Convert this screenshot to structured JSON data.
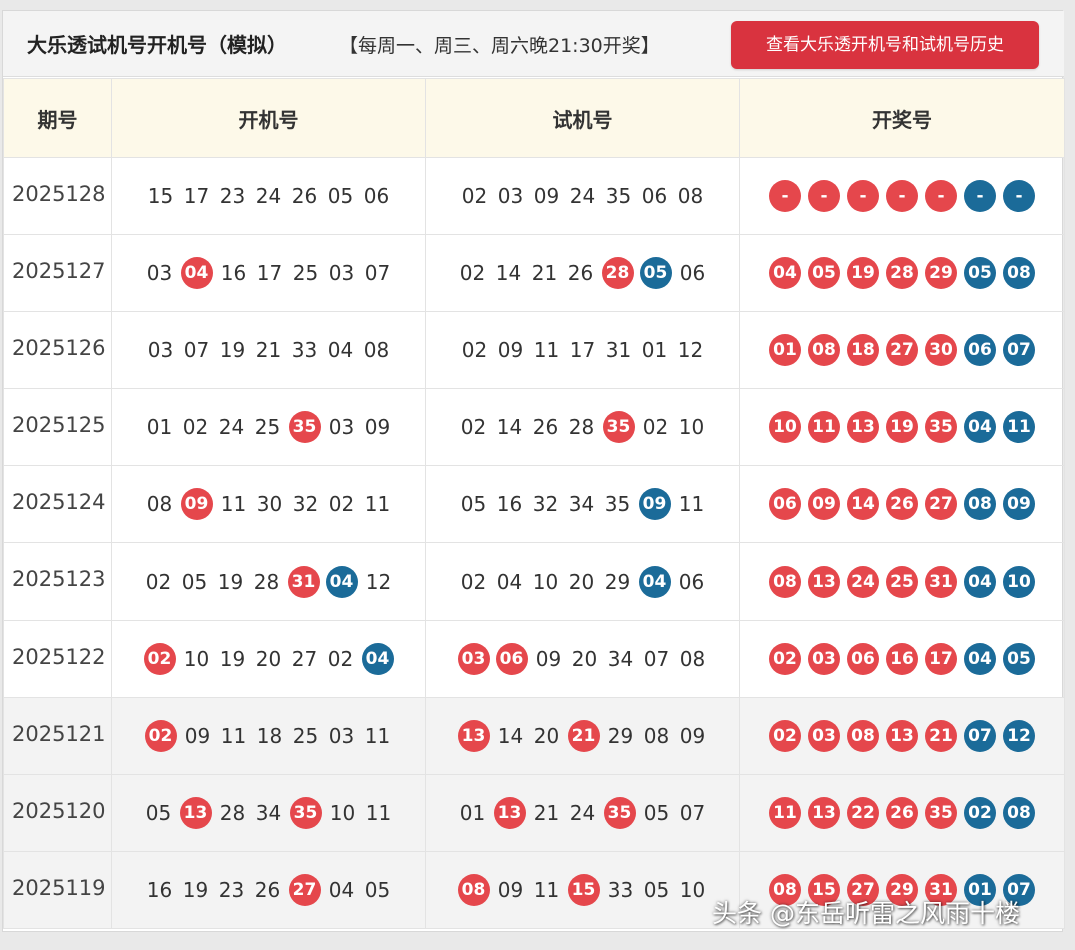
{
  "header": {
    "title": "大乐透试机号开机号（模拟）",
    "schedule": "【每周一、周三、周六晚21:30开奖】",
    "history_button": "查看大乐透开机号和试机号历史"
  },
  "columns": [
    "期号",
    "开机号",
    "试机号",
    "开奖号"
  ],
  "colors": {
    "red_ball": "#e5474c",
    "blue_ball": "#1b6b99",
    "button": "#d9333f",
    "header_bg": "#fdf9e9"
  },
  "rows": [
    {
      "issue": "2025128",
      "open": [
        [
          "15",
          ""
        ],
        [
          "17",
          ""
        ],
        [
          "23",
          ""
        ],
        [
          "24",
          ""
        ],
        [
          "26",
          ""
        ],
        [
          "05",
          ""
        ],
        [
          "06",
          ""
        ]
      ],
      "trial": [
        [
          "02",
          ""
        ],
        [
          "03",
          ""
        ],
        [
          "09",
          ""
        ],
        [
          "24",
          ""
        ],
        [
          "35",
          ""
        ],
        [
          "06",
          ""
        ],
        [
          "08",
          ""
        ]
      ],
      "result": [
        "-",
        "-",
        "-",
        "-",
        "-",
        "-",
        "-"
      ]
    },
    {
      "issue": "2025127",
      "open": [
        [
          "03",
          ""
        ],
        [
          "04",
          "red"
        ],
        [
          "16",
          ""
        ],
        [
          "17",
          ""
        ],
        [
          "25",
          ""
        ],
        [
          "03",
          ""
        ],
        [
          "07",
          ""
        ]
      ],
      "trial": [
        [
          "02",
          ""
        ],
        [
          "14",
          ""
        ],
        [
          "21",
          ""
        ],
        [
          "26",
          ""
        ],
        [
          "28",
          "red"
        ],
        [
          "05",
          "blue"
        ],
        [
          "06",
          ""
        ]
      ],
      "result": [
        "04",
        "05",
        "19",
        "28",
        "29",
        "05",
        "08"
      ]
    },
    {
      "issue": "2025126",
      "open": [
        [
          "03",
          ""
        ],
        [
          "07",
          ""
        ],
        [
          "19",
          ""
        ],
        [
          "21",
          ""
        ],
        [
          "33",
          ""
        ],
        [
          "04",
          ""
        ],
        [
          "08",
          ""
        ]
      ],
      "trial": [
        [
          "02",
          ""
        ],
        [
          "09",
          ""
        ],
        [
          "11",
          ""
        ],
        [
          "17",
          ""
        ],
        [
          "31",
          ""
        ],
        [
          "01",
          ""
        ],
        [
          "12",
          ""
        ]
      ],
      "result": [
        "01",
        "08",
        "18",
        "27",
        "30",
        "06",
        "07"
      ]
    },
    {
      "issue": "2025125",
      "open": [
        [
          "01",
          ""
        ],
        [
          "02",
          ""
        ],
        [
          "24",
          ""
        ],
        [
          "25",
          ""
        ],
        [
          "35",
          "red"
        ],
        [
          "03",
          ""
        ],
        [
          "09",
          ""
        ]
      ],
      "trial": [
        [
          "02",
          ""
        ],
        [
          "14",
          ""
        ],
        [
          "26",
          ""
        ],
        [
          "28",
          ""
        ],
        [
          "35",
          "red"
        ],
        [
          "02",
          ""
        ],
        [
          "10",
          ""
        ]
      ],
      "result": [
        "10",
        "11",
        "13",
        "19",
        "35",
        "04",
        "11"
      ]
    },
    {
      "issue": "2025124",
      "open": [
        [
          "08",
          ""
        ],
        [
          "09",
          "red"
        ],
        [
          "11",
          ""
        ],
        [
          "30",
          ""
        ],
        [
          "32",
          ""
        ],
        [
          "02",
          ""
        ],
        [
          "11",
          ""
        ]
      ],
      "trial": [
        [
          "05",
          ""
        ],
        [
          "16",
          ""
        ],
        [
          "32",
          ""
        ],
        [
          "34",
          ""
        ],
        [
          "35",
          ""
        ],
        [
          "09",
          "blue"
        ],
        [
          "11",
          ""
        ]
      ],
      "result": [
        "06",
        "09",
        "14",
        "26",
        "27",
        "08",
        "09"
      ]
    },
    {
      "issue": "2025123",
      "open": [
        [
          "02",
          ""
        ],
        [
          "05",
          ""
        ],
        [
          "19",
          ""
        ],
        [
          "28",
          ""
        ],
        [
          "31",
          "red"
        ],
        [
          "04",
          "blue"
        ],
        [
          "12",
          ""
        ]
      ],
      "trial": [
        [
          "02",
          ""
        ],
        [
          "04",
          ""
        ],
        [
          "10",
          ""
        ],
        [
          "20",
          ""
        ],
        [
          "29",
          ""
        ],
        [
          "04",
          "blue"
        ],
        [
          "06",
          ""
        ]
      ],
      "result": [
        "08",
        "13",
        "24",
        "25",
        "31",
        "04",
        "10"
      ]
    },
    {
      "issue": "2025122",
      "open": [
        [
          "02",
          "red"
        ],
        [
          "10",
          ""
        ],
        [
          "19",
          ""
        ],
        [
          "20",
          ""
        ],
        [
          "27",
          ""
        ],
        [
          "02",
          ""
        ],
        [
          "04",
          "blue"
        ]
      ],
      "trial": [
        [
          "03",
          "red"
        ],
        [
          "06",
          "red"
        ],
        [
          "09",
          ""
        ],
        [
          "20",
          ""
        ],
        [
          "34",
          ""
        ],
        [
          "07",
          ""
        ],
        [
          "08",
          ""
        ]
      ],
      "result": [
        "02",
        "03",
        "06",
        "16",
        "17",
        "04",
        "05"
      ]
    },
    {
      "issue": "2025121",
      "open": [
        [
          "02",
          "red"
        ],
        [
          "09",
          ""
        ],
        [
          "11",
          ""
        ],
        [
          "18",
          ""
        ],
        [
          "25",
          ""
        ],
        [
          "03",
          ""
        ],
        [
          "11",
          ""
        ]
      ],
      "trial": [
        [
          "13",
          "red"
        ],
        [
          "14",
          ""
        ],
        [
          "20",
          ""
        ],
        [
          "21",
          "red"
        ],
        [
          "29",
          ""
        ],
        [
          "08",
          ""
        ],
        [
          "09",
          ""
        ]
      ],
      "result": [
        "02",
        "03",
        "08",
        "13",
        "21",
        "07",
        "12"
      ]
    },
    {
      "issue": "2025120",
      "open": [
        [
          "05",
          ""
        ],
        [
          "13",
          "red"
        ],
        [
          "28",
          ""
        ],
        [
          "34",
          ""
        ],
        [
          "35",
          "red"
        ],
        [
          "10",
          ""
        ],
        [
          "11",
          ""
        ]
      ],
      "trial": [
        [
          "01",
          ""
        ],
        [
          "13",
          "red"
        ],
        [
          "21",
          ""
        ],
        [
          "24",
          ""
        ],
        [
          "35",
          "red"
        ],
        [
          "05",
          ""
        ],
        [
          "07",
          ""
        ]
      ],
      "result": [
        "11",
        "13",
        "22",
        "26",
        "35",
        "02",
        "08"
      ]
    },
    {
      "issue": "2025119",
      "open": [
        [
          "16",
          ""
        ],
        [
          "19",
          ""
        ],
        [
          "23",
          ""
        ],
        [
          "26",
          ""
        ],
        [
          "27",
          "red"
        ],
        [
          "04",
          ""
        ],
        [
          "05",
          ""
        ]
      ],
      "trial": [
        [
          "08",
          "red"
        ],
        [
          "09",
          ""
        ],
        [
          "11",
          ""
        ],
        [
          "15",
          "red"
        ],
        [
          "33",
          ""
        ],
        [
          "05",
          ""
        ],
        [
          "10",
          ""
        ]
      ],
      "result": [
        "08",
        "15",
        "27",
        "29",
        "31",
        "01",
        "07"
      ]
    }
  ],
  "watermark": "头条 @东岳听雷之风雨十楼"
}
